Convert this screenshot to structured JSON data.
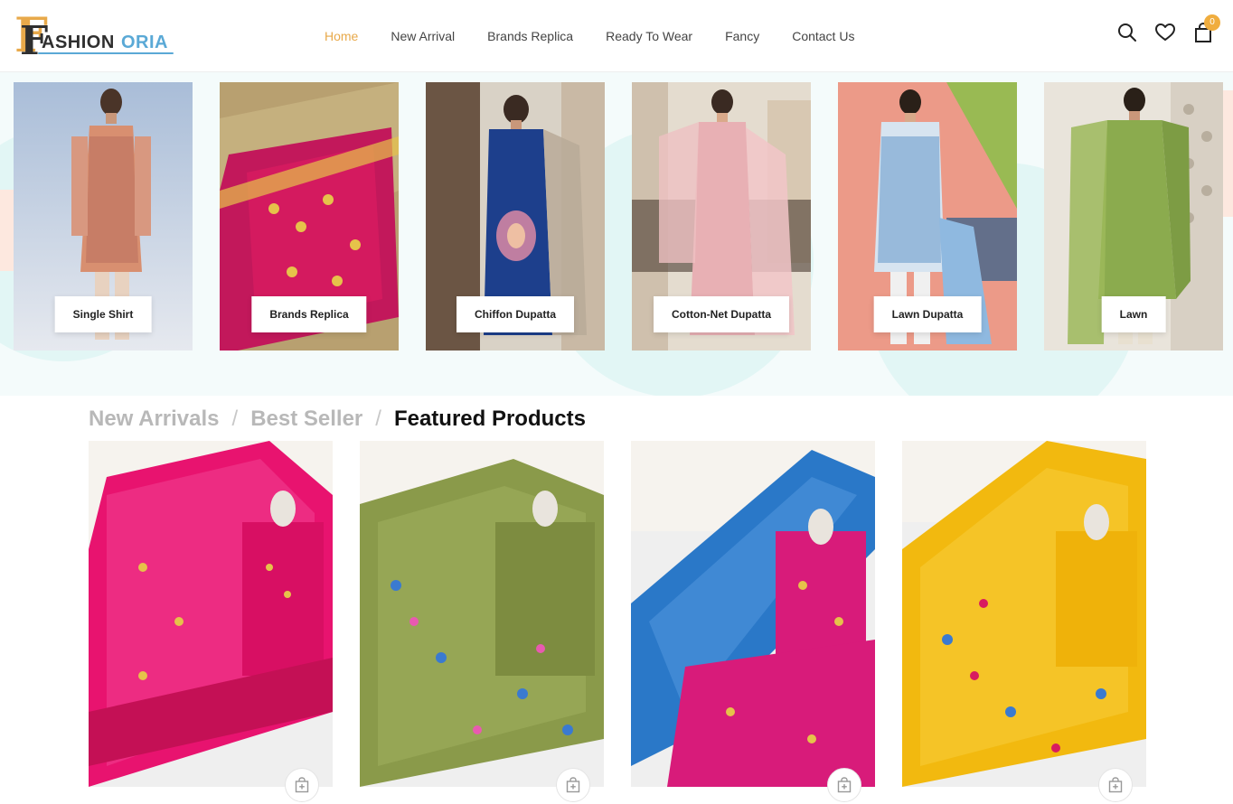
{
  "brand": {
    "logo_part1": "ASHION",
    "logo_part2": "ORIA",
    "logo_letter": "F"
  },
  "nav": {
    "items": [
      {
        "label": "Home",
        "active": true
      },
      {
        "label": "New Arrival",
        "active": false
      },
      {
        "label": "Brands Replica",
        "active": false
      },
      {
        "label": "Ready To Wear",
        "active": false
      },
      {
        "label": "Fancy",
        "active": false
      },
      {
        "label": "Contact Us",
        "active": false
      }
    ]
  },
  "header_icons": {
    "search": "search-icon",
    "wishlist": "heart-icon",
    "cart": "shopping-bag-icon",
    "cart_count": "0"
  },
  "categories": [
    {
      "label": "Single Shirt"
    },
    {
      "label": "Brands Replica"
    },
    {
      "label": "Chiffon Dupatta"
    },
    {
      "label": "Cotton-Net Dupatta"
    },
    {
      "label": "Lawn Dupatta"
    },
    {
      "label": "Lawn"
    }
  ],
  "tabs": [
    {
      "label": "New Arrivals",
      "active": false
    },
    {
      "label": "Best Seller",
      "active": false
    },
    {
      "label": "Featured Products",
      "active": true
    }
  ],
  "tab_separator": "/",
  "products": [
    {
      "color": "#e8136f",
      "icon": "add-to-cart-icon"
    },
    {
      "color": "#8a9a4a",
      "icon": "add-to-cart-icon"
    },
    {
      "color": "#2a78c8",
      "icon": "add-to-cart-icon"
    },
    {
      "color": "#f2b90f",
      "icon": "add-to-cart-icon"
    }
  ],
  "colors": {
    "accent": "#e8a94a",
    "badge": "#f0ad3e",
    "logo_blue": "#5aa9d6"
  }
}
